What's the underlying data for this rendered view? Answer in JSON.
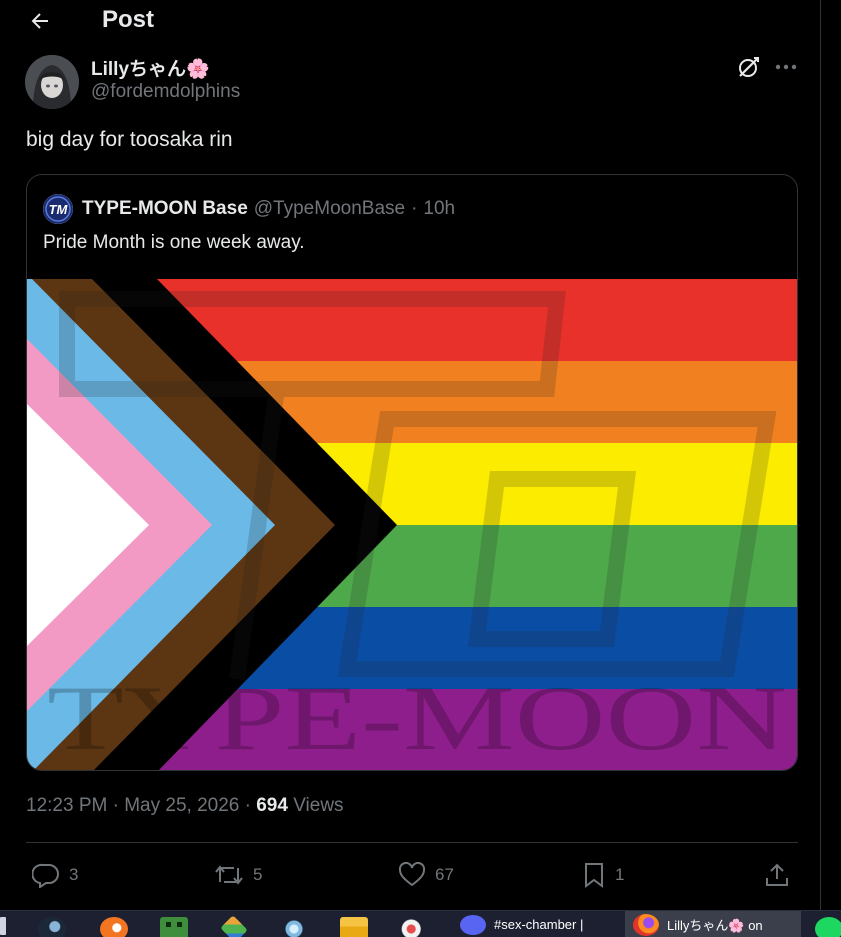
{
  "header": {
    "title": "Post"
  },
  "post": {
    "author_name": "Lillyちゃん🌸",
    "author_handle": "@fordemdolphins",
    "text": "big day for toosaka rin",
    "timestamp": "12:23 PM · May 25, 2026 · ",
    "views_count": "694",
    "views_label": " Views"
  },
  "quoted": {
    "name": "TYPE-MOON Base",
    "handle": "@TypeMoonBase",
    "separator": "·",
    "time": "10h",
    "text": "Pride Month is one week away.",
    "watermark": "TYPE-MOON"
  },
  "actions": {
    "replies": "3",
    "reposts": "5",
    "likes": "67",
    "bookmarks": "1"
  },
  "taskbar": {
    "apps": [
      {
        "icon": "steam-icon"
      },
      {
        "icon": "crunchyroll-icon"
      },
      {
        "icon": "minecraft-icon"
      },
      {
        "icon": "package-icon"
      },
      {
        "icon": "snowflake-icon"
      },
      {
        "icon": "file-explorer-icon"
      },
      {
        "icon": "paint-icon"
      }
    ],
    "discord_label": "#sex-chamber |",
    "firefox_label": "Lillyちゃん🌸 on"
  },
  "colors": {
    "background": "#000000",
    "text_primary": "#e7e9ea",
    "text_secondary": "#71767b",
    "border": "#2f3336",
    "flag_red": "#e8312a",
    "flag_orange": "#f08020",
    "flag_yellow": "#fcec00",
    "flag_green": "#4ea94a",
    "flag_blue": "#0a4da5",
    "flag_purple": "#8e1e8c",
    "trans_blue": "#6bb9e7",
    "trans_pink": "#f29ac4",
    "brown": "#5c3512"
  }
}
